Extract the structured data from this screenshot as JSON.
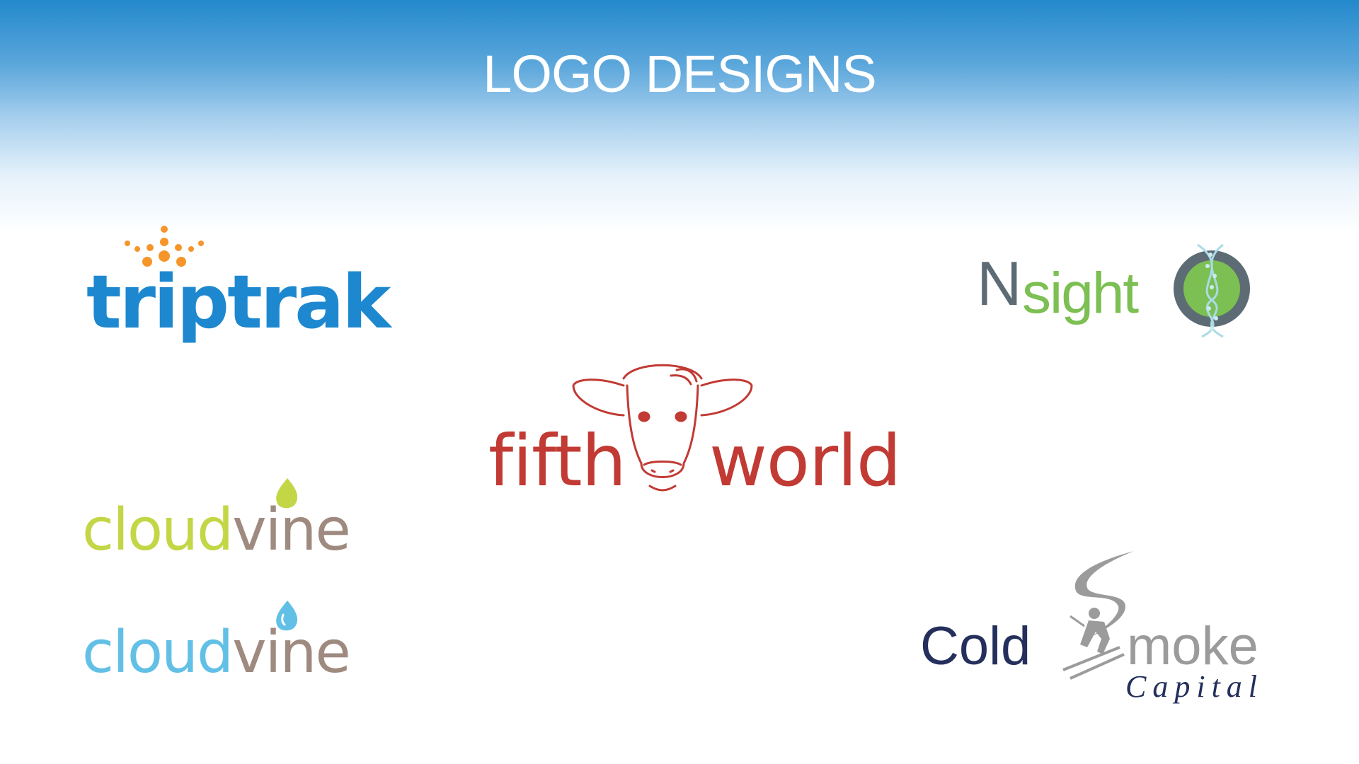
{
  "slide": {
    "title": "LOGO DESIGNS"
  },
  "logos": {
    "triptrak": {
      "text": "triptrak",
      "color": "#1d88cf",
      "dot_color": "#f5952a"
    },
    "nsight": {
      "letter": "N",
      "text": "sight",
      "n_color": "#5d6b75",
      "text_color": "#7cbf52",
      "mark": "dna-helix-circle-icon"
    },
    "fifthworld": {
      "left": "fifth",
      "right": "world",
      "color": "#c13a33",
      "mark": "cow-head-icon"
    },
    "cloudvine_green": {
      "cloud": "cloud",
      "vine": "vine",
      "cloud_color": "#c3d645",
      "vine_color": "#9f8a80"
    },
    "cloudvine_blue": {
      "cloud": "cloud",
      "vine": "vine",
      "cloud_color": "#62c0e6",
      "vine_color": "#9f8a80"
    },
    "coldsmoke": {
      "cold": "Cold",
      "moke": "moke",
      "capital": "Capital",
      "navy": "#242f5c",
      "gray": "#9b9b9b",
      "mark": "skier-s-icon"
    }
  }
}
